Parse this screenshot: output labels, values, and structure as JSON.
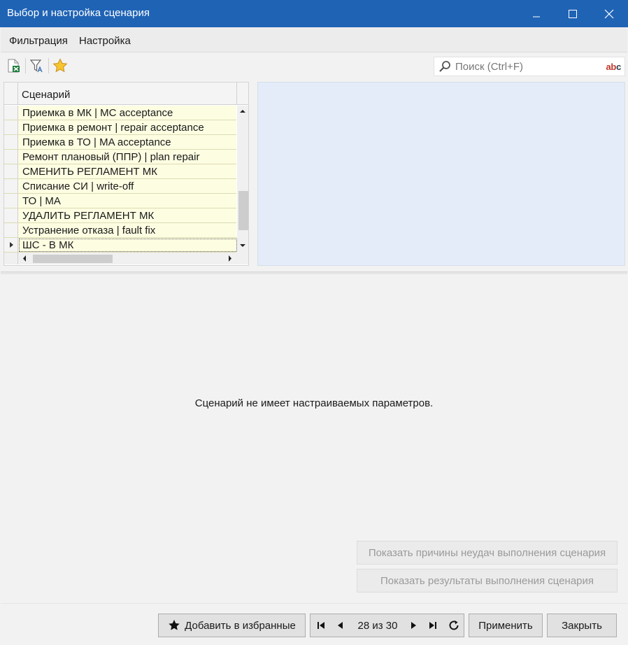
{
  "window": {
    "title": "Выбор и настройка сценария"
  },
  "menu": {
    "items": [
      "Фильтрация",
      "Настройка"
    ]
  },
  "toolbar": {
    "icons": [
      "export-excel-icon",
      "filter-clear-icon",
      "favorite-star-icon"
    ]
  },
  "search": {
    "placeholder": "Поиск (Ctrl+F)",
    "spell_badge_red": "ab",
    "spell_badge_dark": "c"
  },
  "grid": {
    "column_header": "Сценарий",
    "rows": [
      "Приемка в МК | MC acceptance",
      "Приемка в ремонт | repair acceptance",
      "Приемка в ТО | MA acceptance",
      "Ремонт плановый (ППР) | plan repair",
      "СМЕНИТЬ РЕГЛАМЕНТ МК",
      "Списание СИ | write-off",
      "ТО | MA",
      "УДАЛИТЬ РЕГЛАМЕНТ МК",
      "Устранение отказа | fault fix",
      "ШС - В МК"
    ],
    "current_row_index": 9
  },
  "params": {
    "message": "Сценарий не имеет настраиваемых параметров."
  },
  "actions": {
    "show_failures": "Показать причины неудач выполнения сценария",
    "show_results": "Показать результаты выполнения сценария"
  },
  "footer": {
    "add_favorite": "Добавить в избранные",
    "counter": "28 из 30",
    "apply": "Применить",
    "close": "Закрыть"
  },
  "colors": {
    "titlebar": "#1f63b5",
    "row_bg": "#fdfde2",
    "preview_bg": "#e3ecf8"
  }
}
